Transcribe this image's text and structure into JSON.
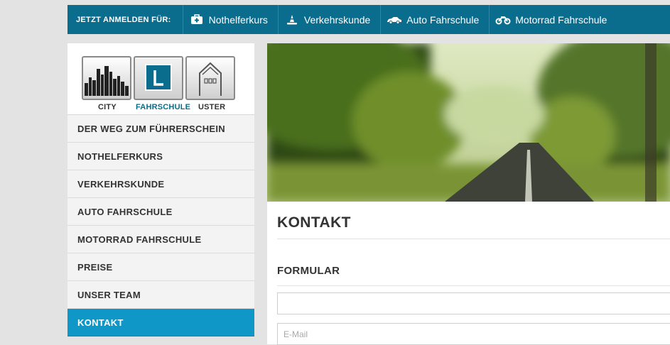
{
  "topbar": {
    "lead": "JETZT ANMELDEN FÜR:",
    "items": [
      {
        "label": "Nothelferkurs",
        "icon": "first-aid-kit-icon"
      },
      {
        "label": "Verkehrskunde",
        "icon": "traffic-cone-icon"
      },
      {
        "label": "Auto Fahrschule",
        "icon": "car-icon"
      },
      {
        "label": "Motorrad Fahrschule",
        "icon": "motorcycle-icon"
      }
    ]
  },
  "logo": {
    "captions": [
      "CITY",
      "FAHRSCHULE",
      "USTER"
    ]
  },
  "sidebar": {
    "items": [
      {
        "label": "DER WEG ZUM FÜHRERSCHEIN"
      },
      {
        "label": "NOTHELFERKURS"
      },
      {
        "label": "VERKEHRSKUNDE"
      },
      {
        "label": "AUTO FAHRSCHULE"
      },
      {
        "label": "MOTORRAD FAHRSCHULE"
      },
      {
        "label": "PREISE"
      },
      {
        "label": "UNSER TEAM"
      },
      {
        "label": "KONTAKT"
      }
    ],
    "active": "KONTAKT"
  },
  "main": {
    "title": "KONTAKT",
    "section": "FORMULAR",
    "email_placeholder": "E-Mail"
  },
  "colors": {
    "brand": "#0a6d8e",
    "active": "#0e97c7",
    "background": "#e3e3e3"
  }
}
